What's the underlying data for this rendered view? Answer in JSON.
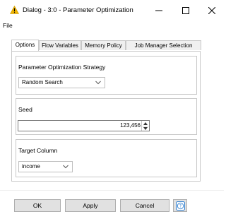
{
  "window": {
    "title": "Dialog - 3:0 - Parameter Optimization",
    "icon": "warning-icon",
    "controls": {
      "minimize": "minimize-icon",
      "maximize": "maximize-icon",
      "close": "close-icon"
    }
  },
  "menu": {
    "file": "File"
  },
  "tabs": [
    {
      "label": "Options",
      "active": true
    },
    {
      "label": "Flow Variables",
      "active": false
    },
    {
      "label": "Memory Policy",
      "active": false
    },
    {
      "label": "Job Manager Selection",
      "active": false
    }
  ],
  "options": {
    "strategy": {
      "label": "Parameter Optimization Strategy",
      "selected": "Random Search"
    },
    "seed": {
      "label": "Seed",
      "value": "123,456"
    },
    "target_column": {
      "label": "Target Column",
      "selected": "income"
    }
  },
  "buttons": {
    "ok": "OK",
    "apply": "Apply",
    "cancel": "Cancel",
    "help": "help-icon"
  },
  "colors": {
    "warning": "#f0b400",
    "help_accent": "#2f7fd0",
    "border": "#c8c8c8"
  }
}
